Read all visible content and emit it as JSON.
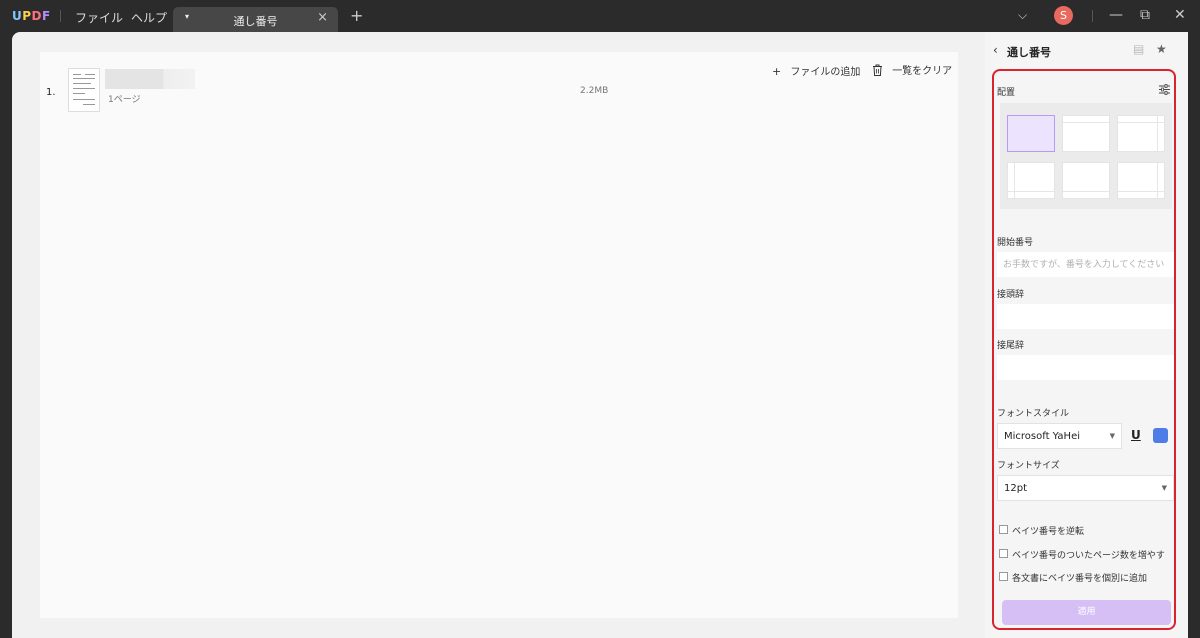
{
  "app": {
    "logo": [
      "U",
      "P",
      "D",
      "F"
    ]
  },
  "menu": {
    "file": "ファイル",
    "help": "ヘルプ"
  },
  "tab": {
    "title": "通し番号",
    "close_glyph": "×",
    "drop_glyph": "▾"
  },
  "new_tab_glyph": "+",
  "user": {
    "initial": "S"
  },
  "window_controls": {
    "chevron": "⌵",
    "minimize": "—",
    "restore": "⧉",
    "close": "✕"
  },
  "toolbar": {
    "add_files": "ファイルの追加",
    "clear_list": "一覧をクリア"
  },
  "files": [
    {
      "index": "1.",
      "pages": "1ページ",
      "size": "2.2MB"
    }
  ],
  "panel": {
    "title": "通し番号",
    "placement_label": "配置",
    "start_number_label": "開始番号",
    "start_number_placeholder": "お手数ですが、番号を入力してください",
    "prefix_label": "接頭辞",
    "suffix_label": "接尾辞",
    "font_style_label": "フォントスタイル",
    "font_family": "Microsoft YaHei",
    "underline_glyph": "U",
    "font_size_label": "フォントサイズ",
    "font_size": "12pt",
    "options": [
      "ベイツ番号を逆転",
      "ベイツ番号のついたページ数を増やす",
      "各文書にベイツ番号を個別に追加"
    ],
    "apply_label": "適用"
  },
  "colors": {
    "font_color": "#4f7de8",
    "apply_bg": "#d6bff5",
    "highlight_border": "#d9232e"
  }
}
